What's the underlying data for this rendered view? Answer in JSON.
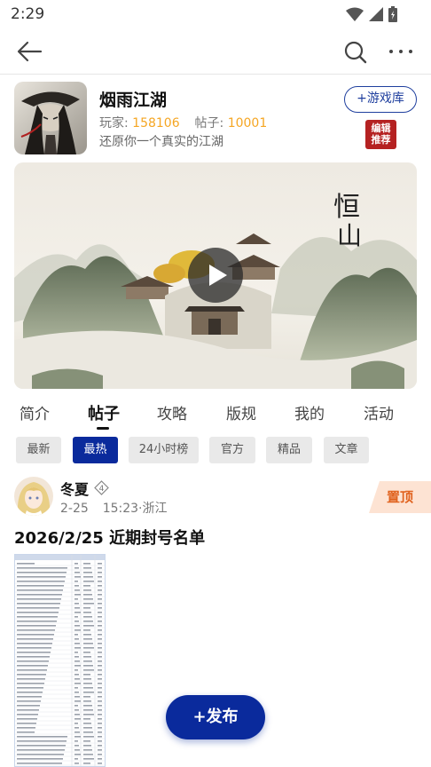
{
  "status_bar": {
    "time": "2:29"
  },
  "game": {
    "title": "烟雨江湖",
    "players_label": "玩家:",
    "players_count": "158106",
    "posts_label": "帖子:",
    "posts_count": "10001",
    "slogan": "还原你一个真实的江湖",
    "add_library_label": "+游戏库",
    "editor_pick_line1": "编辑",
    "editor_pick_line2": "推荐"
  },
  "banner": {
    "calligraphy_line1": "恒",
    "calligraphy_line2": "山"
  },
  "tabs": [
    {
      "label": "简介"
    },
    {
      "label": "帖子"
    },
    {
      "label": "攻略"
    },
    {
      "label": "版规"
    },
    {
      "label": "我的"
    },
    {
      "label": "活动"
    }
  ],
  "active_tab": "帖子",
  "filters": [
    {
      "label": "最新"
    },
    {
      "label": "最热"
    },
    {
      "label": "24小时榜"
    },
    {
      "label": "官方"
    },
    {
      "label": "精品"
    },
    {
      "label": "文章"
    }
  ],
  "active_filter": "最热",
  "post": {
    "author": "冬夏",
    "level": "4",
    "date": "2-25",
    "time": "15:23",
    "location": "浙江",
    "pinned_label": "置顶",
    "title": "2026/2/25 近期封号名单"
  },
  "fab": {
    "label": "+发布"
  },
  "colors": {
    "accent_blue": "#0a2a9c",
    "stat_orange": "#f5a623",
    "pinned_orange": "#e0621e",
    "editor_red": "#b52222"
  }
}
